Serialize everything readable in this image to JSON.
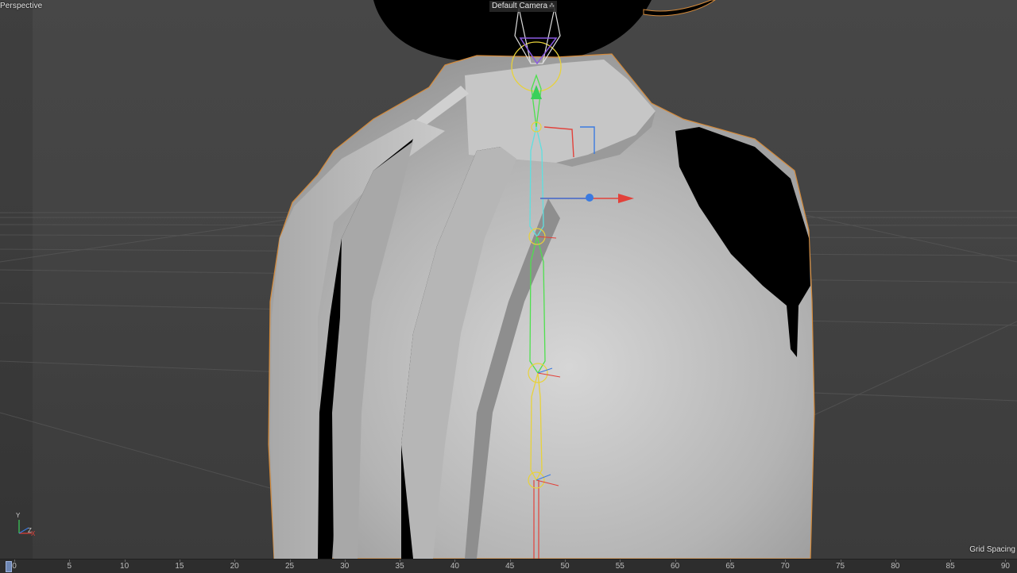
{
  "viewport": {
    "view_label": "Perspective",
    "camera_label": "Default Camera",
    "camera_icon": "camera-dots-icon",
    "grid_spacing_label": "Grid Spacing",
    "axis_gizmo": {
      "y_label": "Y",
      "z_label": "Z",
      "x_label": "X"
    }
  },
  "timeline": {
    "current_frame": "0",
    "ticks": [
      "0",
      "5",
      "10",
      "15",
      "20",
      "25",
      "30",
      "35",
      "40",
      "45",
      "50",
      "55",
      "60",
      "65",
      "70",
      "75",
      "80",
      "85",
      "90"
    ],
    "playhead_color": "#6d86b3"
  },
  "colors": {
    "selection_outline": "#d48a3a",
    "bone_yellow": "#e8d23a",
    "bone_cyan": "#5fe0e0",
    "bone_green": "#4ee04e",
    "axis_red": "#e2413a",
    "axis_blue": "#3a7ae0",
    "axis_green": "#3ad05a"
  }
}
